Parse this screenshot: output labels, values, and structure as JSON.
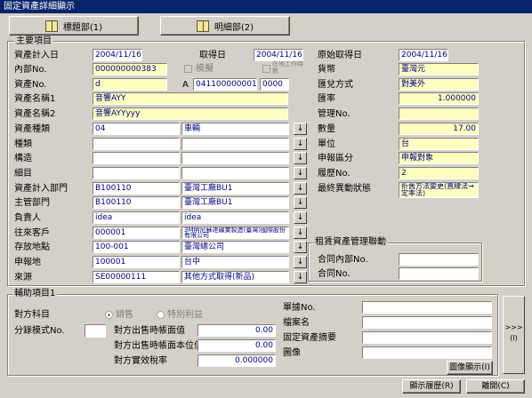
{
  "window": {
    "title": "固定資產詳細顯示"
  },
  "tabs": [
    {
      "label": "標題部(1)"
    },
    {
      "label": "明細部(2)"
    }
  ],
  "main": {
    "group": "主要項目",
    "rows": [
      {
        "label": "資產計入日",
        "value": "2004/11/16"
      },
      {
        "label": "內部No.",
        "value": "000000000383"
      },
      {
        "label": "資產No.",
        "value": "d"
      },
      {
        "label": "資產名稱1",
        "value": "音響AYY"
      },
      {
        "label": "資產名稱2",
        "value": "音響AYYyyy"
      },
      {
        "label": "資產種類",
        "code": "04",
        "name": "車輛"
      },
      {
        "label": "種類",
        "code": "",
        "name": ""
      },
      {
        "label": "構造",
        "code": "",
        "name": ""
      },
      {
        "label": "細目",
        "code": "",
        "name": ""
      },
      {
        "label": "資產計入部門",
        "code": "B100110",
        "name": "臺灣工廠BU1"
      },
      {
        "label": "主管部門",
        "code": "B100110",
        "name": "臺灣工廠BU1"
      },
      {
        "label": "負責人",
        "code": "idea",
        "name": "idea"
      },
      {
        "label": "往來客戶",
        "code": "000001",
        "name": "3M明尼蘇達礦業製造(臺灣)國際股份有限公司"
      },
      {
        "label": "存放地點",
        "code": "100-001",
        "name": "臺灣總公司"
      },
      {
        "label": "申報地",
        "code": "100001",
        "name": "台中"
      },
      {
        "label": "來源",
        "code": "SE00000111",
        "name": "其他方式取得(新品)"
      }
    ],
    "acq_date_label": "取得日",
    "acq_date": "2004/11/16",
    "mold_label": "模擬",
    "cost_label": "在地工作時數",
    "a_label": "A",
    "asset_no2": "041100000001",
    "asset_no3": "0000",
    "right": [
      {
        "label": "原始取得日",
        "value": "2004/11/16"
      },
      {
        "label": "貨幣",
        "value": "臺灣元"
      },
      {
        "label": "匯兌方式",
        "value": "對美外"
      },
      {
        "label": "匯率",
        "value": "1.000000"
      },
      {
        "label": "管理No.",
        "value": ""
      },
      {
        "label": "數量",
        "value": "17.00"
      },
      {
        "label": "單位",
        "value": "台"
      },
      {
        "label": "申報區分",
        "value": "申報對象"
      },
      {
        "label": "履歷No.",
        "value": "2"
      },
      {
        "label": "最終異動狀態",
        "value": "折舊方法變更(直線法→定率法)"
      }
    ],
    "lease_group": "租賃資產管理聯動",
    "lease": [
      {
        "label": "合同內部No.",
        "value": ""
      },
      {
        "label": "合同No.",
        "value": ""
      }
    ]
  },
  "aux": {
    "group": "輔助項目1",
    "counter_label": "對方科目",
    "radio1": "銷售",
    "radio2": "特別利益",
    "split_label": "分錄模式No.",
    "split_value": "",
    "sale_rows": [
      {
        "label": "對方出售時帳面值",
        "value": "0.00"
      },
      {
        "label": "對方出售時帳面本位值",
        "value": "0.00"
      },
      {
        "label": "對方實效稅率",
        "value": "0.000000"
      }
    ],
    "right_rows": [
      {
        "label": "單據No.",
        "value": ""
      },
      {
        "label": "檔案名",
        "value": ""
      },
      {
        "label": "固定資產摘要",
        "value": ""
      },
      {
        "label": "圖像",
        "value": ""
      }
    ],
    "image_btn": "圖像顯示(I)",
    "next_arrows": ">>>",
    "next_key": "(I)"
  },
  "footer": {
    "history_btn": "顯示履歷(R)",
    "close_btn": "離開(C)"
  },
  "lookup_symbol": "↓"
}
